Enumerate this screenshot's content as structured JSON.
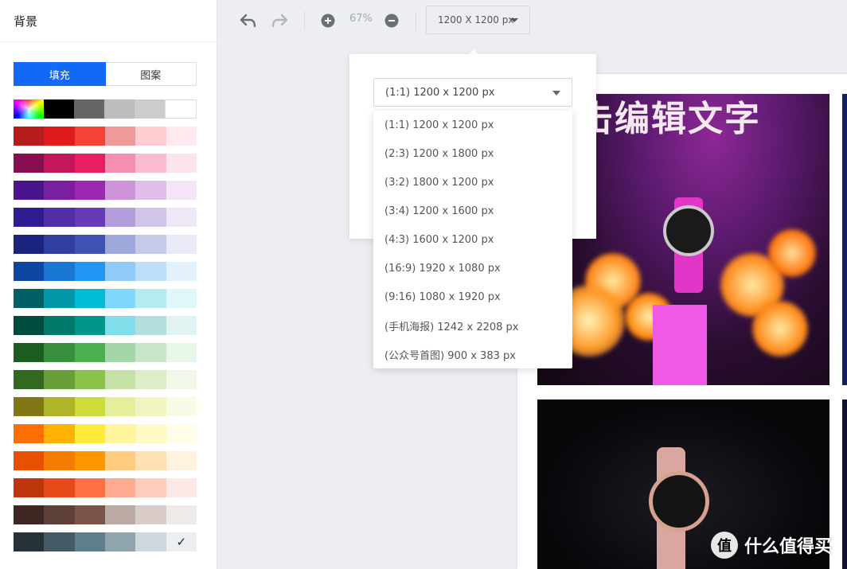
{
  "sidebar": {
    "title": "背景",
    "tabs": [
      {
        "label": "填充",
        "active": true
      },
      {
        "label": "图案",
        "active": false
      }
    ],
    "palette": [
      [
        "rainbow",
        "#000000",
        "#666666",
        "#bdbdbd",
        "#cccccc",
        "#ffffff"
      ],
      [
        "#b71c1c",
        "#e01b1b",
        "#f34236",
        "#ef9a9a",
        "#ffcdd2",
        "#ffebee"
      ],
      [
        "#880e4f",
        "#c2185b",
        "#e91e63",
        "#f48fb1",
        "#f8bbd0",
        "#fce4ec"
      ],
      [
        "#4a148c",
        "#7b1fa2",
        "#9c27b0",
        "#ce93d8",
        "#e1bee7",
        "#f3e5f5"
      ],
      [
        "#311b92",
        "#512da8",
        "#673ab7",
        "#b39ddb",
        "#d1c4e9",
        "#ede7f6"
      ],
      [
        "#1a237e",
        "#303f9f",
        "#3f51b5",
        "#9fa8da",
        "#c5cae9",
        "#e8eaf6"
      ],
      [
        "#0d47a1",
        "#1976d2",
        "#2196f3",
        "#90caf9",
        "#bbdefb",
        "#e3f2fd"
      ],
      [
        "#006064",
        "#0097a7",
        "#00bcd4",
        "#80d8ff",
        "#b2ebf2",
        "#e0f7fa"
      ],
      [
        "#004d40",
        "#00796b",
        "#009688",
        "#80deea",
        "#b2dfdb",
        "#e0f2f1"
      ],
      [
        "#1b5e20",
        "#388e3c",
        "#4caf50",
        "#a5d6a7",
        "#c8e6c9",
        "#e8f5e9"
      ],
      [
        "#33691e",
        "#689f38",
        "#8bc34a",
        "#c5e1a5",
        "#dcedc8",
        "#f1f8e9"
      ],
      [
        "#827717",
        "#afb42b",
        "#cddc39",
        "#e6ee9c",
        "#f0f4c3",
        "#f9fbe7"
      ],
      [
        "#ff6f00",
        "#ffb300",
        "#ffeb3b",
        "#fff59d",
        "#fff9c4",
        "#fffde7"
      ],
      [
        "#e65100",
        "#f57c00",
        "#ff9800",
        "#ffcc80",
        "#ffe0b2",
        "#fff3e0"
      ],
      [
        "#bf360c",
        "#e64a19",
        "#ff7043",
        "#ffab91",
        "#ffccbc",
        "#fbe9e7"
      ],
      [
        "#3e2723",
        "#5d4037",
        "#795548",
        "#bcaaa4",
        "#d7ccc8",
        "#efebe9"
      ],
      [
        "#263238",
        "#455a64",
        "#607d8b",
        "#90a4ae",
        "#cfd8dc",
        "#eceff1"
      ]
    ],
    "selected_mark": "✓"
  },
  "toolbar": {
    "zoom": "67%",
    "size_label": "1200 X 1200 px"
  },
  "popup": {
    "selected": "(1:1) 1200 x 1200 px",
    "options": [
      "(1:1) 1200 x 1200 px",
      "(2:3) 1200 x 1800 px",
      "(3:2) 1800 x 1200 px",
      "(3:4) 1200 x 1600 px",
      "(4:3) 1600 x 1200 px",
      "(16:9) 1920 x 1080 px",
      "(9:16) 1080 x 1920 px",
      "(手机海报) 1242 x 2208 px",
      "(公众号首图) 900 x 383 px"
    ]
  },
  "canvas": {
    "headline": "双击编辑文字"
  },
  "watermark": {
    "logo": "值",
    "text": "什么值得买"
  }
}
